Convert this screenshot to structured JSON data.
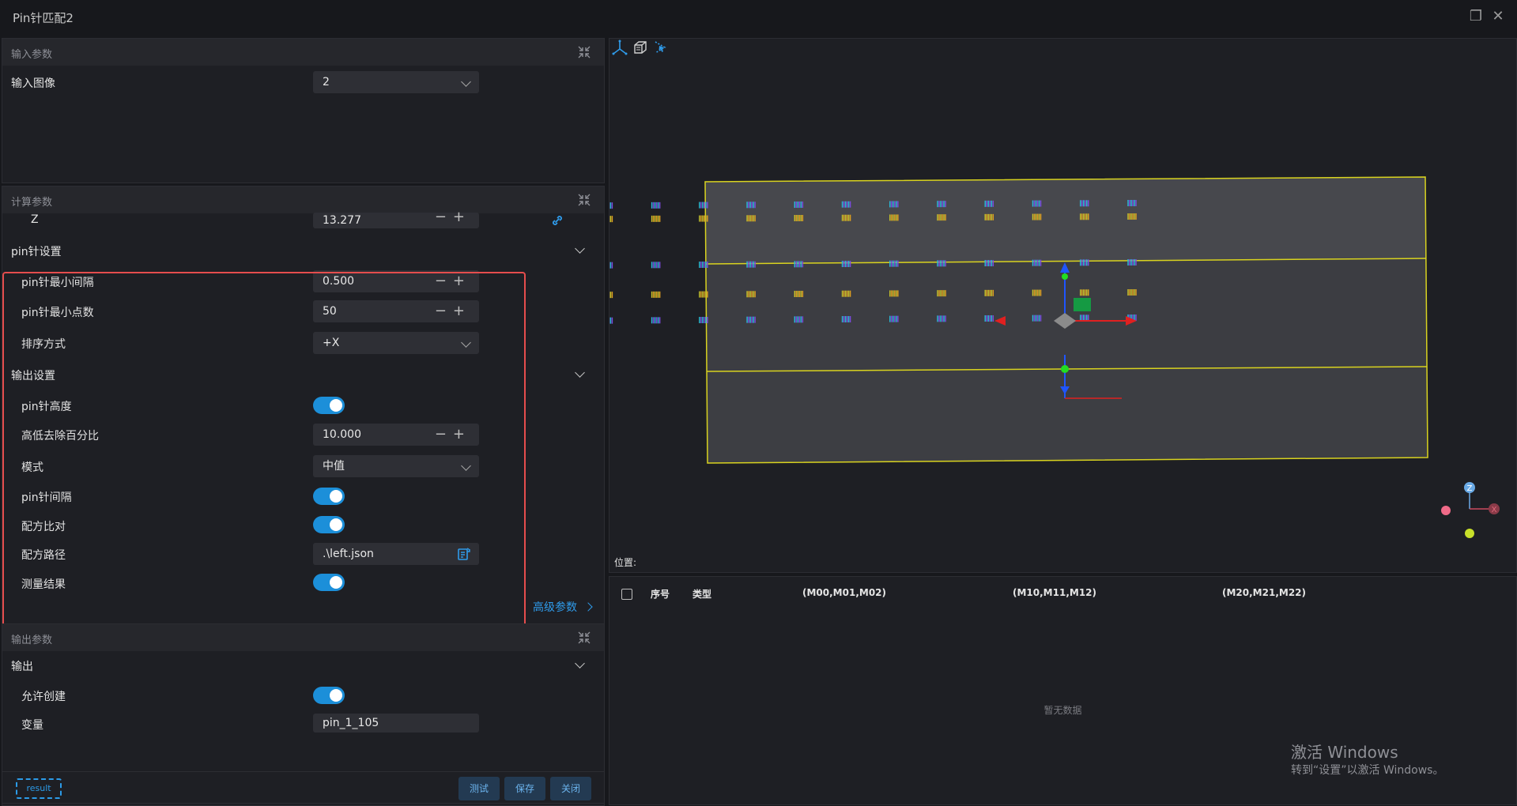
{
  "window": {
    "title": "Pin针匹配2"
  },
  "input_params": {
    "header": "输入参数",
    "image_label": "输入图像",
    "image_value": "2"
  },
  "calc_params": {
    "header": "计算参数",
    "z_label": "Z",
    "z_value": "13.277",
    "pin_section": "pin针设置",
    "min_spacing_label": "pin针最小间隔",
    "min_spacing_value": "0.500",
    "min_points_label": "pin针最小点数",
    "min_points_value": "50",
    "sort_label": "排序方式",
    "sort_value": "+X",
    "output_section": "输出设置",
    "pin_height_label": "pin针高度",
    "pin_height_on": true,
    "trim_percent_label": "高低去除百分比",
    "trim_percent_value": "10.000",
    "mode_label": "模式",
    "mode_value": "中值",
    "pin_spacing_label": "pin针间隔",
    "pin_spacing_on": true,
    "recipe_compare_label": "配方比对",
    "recipe_compare_on": true,
    "recipe_path_label": "配方路径",
    "recipe_path_value": ".\\left.json",
    "measure_result_label": "测量结果",
    "measure_result_on": true,
    "advanced_link": "高级参数"
  },
  "output_params": {
    "header": "输出参数",
    "section": "输出",
    "allow_create_label": "允许创建",
    "allow_create_on": true,
    "variable_label": "变量",
    "variable_value": "pin_1_105"
  },
  "bottom": {
    "result_label": "result",
    "test_label": "测试",
    "save_label": "保存",
    "close_label": "关闭"
  },
  "viewer": {
    "position_label": "位置:",
    "axis_z": "Z",
    "axis_x": "X"
  },
  "table": {
    "columns": [
      "序号",
      "类型",
      "(M00,M01,M02)",
      "(M10,M11,M12)",
      "(M20,M21,M22)"
    ],
    "empty_text": "暂无数据"
  },
  "watermark": {
    "line1": "激活 Windows",
    "line2": "转到“设置”以激活 Windows。"
  },
  "colors": {
    "accent": "#1c8fd9",
    "highlight_border": "#e54d4d",
    "bbox": "#d9d31f"
  }
}
